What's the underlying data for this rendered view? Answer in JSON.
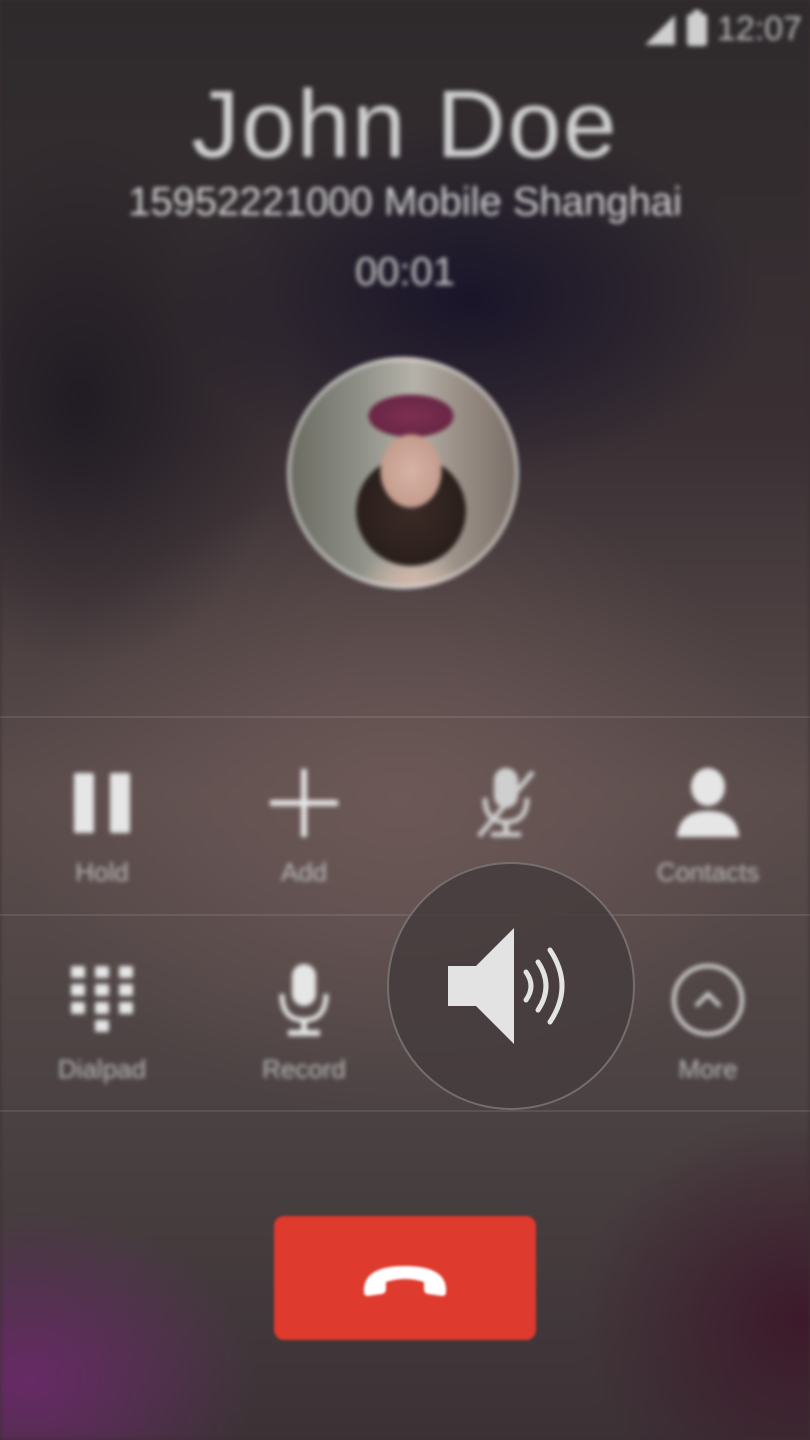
{
  "status_bar": {
    "time": "12:07"
  },
  "caller": {
    "name": "John Doe",
    "details": "15952221000 Mobile Shanghai",
    "duration": "00:01"
  },
  "controls": {
    "row1": [
      {
        "label": "Hold",
        "icon": "pause-icon"
      },
      {
        "label": "Add",
        "icon": "plus-icon"
      },
      {
        "label": "",
        "icon": "mute-mic-icon"
      },
      {
        "label": "Contacts",
        "icon": "person-icon"
      }
    ],
    "row2": [
      {
        "label": "Dialpad",
        "icon": "dialpad-icon"
      },
      {
        "label": "Record",
        "icon": "microphone-icon"
      },
      {
        "label": "",
        "icon": "speaker-icon"
      },
      {
        "label": "More",
        "icon": "chevron-up-icon"
      }
    ]
  },
  "colors": {
    "end_call": "#de3a2d"
  }
}
